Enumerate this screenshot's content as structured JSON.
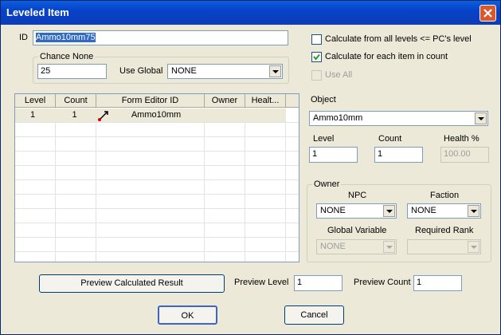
{
  "window": {
    "title": "Leveled Item"
  },
  "id": {
    "label": "ID",
    "value": "Ammo10mm75"
  },
  "chance_none": {
    "group_label": "Chance None",
    "value": "25",
    "use_global_label": "Use Global",
    "use_global_value": "NONE"
  },
  "options": {
    "calc_all_levels": {
      "label": "Calculate from all levels <= PC's level",
      "checked": false
    },
    "calc_each_item": {
      "label": "Calculate for each item in count",
      "checked": true
    },
    "use_all": {
      "label": "Use All",
      "checked": false,
      "disabled": true
    }
  },
  "list": {
    "headers": [
      "Level",
      "Count",
      "Form Editor ID",
      "Owner",
      "Healt..."
    ],
    "rows": [
      {
        "level": "1",
        "count": "1",
        "form_id": "Ammo10mm",
        "owner": "",
        "health": ""
      }
    ]
  },
  "object": {
    "label": "Object",
    "value": "Ammo10mm"
  },
  "fields": {
    "level_label": "Level",
    "level_value": "1",
    "count_label": "Count",
    "count_value": "1",
    "health_label": "Health %",
    "health_value": "100.00"
  },
  "owner": {
    "group_label": "Owner",
    "npc_label": "NPC",
    "npc_value": "NONE",
    "faction_label": "Faction",
    "faction_value": "NONE",
    "global_var_label": "Global Variable",
    "global_var_value": "NONE",
    "required_rank_label": "Required Rank",
    "required_rank_value": ""
  },
  "preview": {
    "button_label": "Preview Calculated Result",
    "level_label": "Preview Level",
    "level_value": "1",
    "count_label": "Preview Count",
    "count_value": "1"
  },
  "buttons": {
    "ok": "OK",
    "cancel": "Cancel"
  },
  "colors": {
    "title_bar": "#0842c8",
    "window_bg": "#ece9d8",
    "selected_text_bg": "#316ac5",
    "close_button": "#d9582e"
  }
}
